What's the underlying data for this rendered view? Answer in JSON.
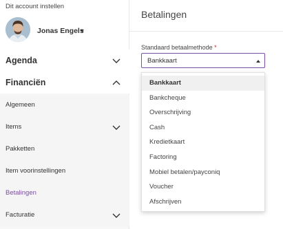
{
  "sidebar": {
    "account_label": "Dit account instellen",
    "user_name": "Jonas Engels",
    "sections": {
      "agenda": "Agenda",
      "financien": "Financiën"
    },
    "subitems": {
      "algemeen": "Algemeen",
      "items": "Items",
      "pakketten": "Pakketten",
      "item_voorinstellingen": "Item voorinstellingen",
      "betalingen": "Betalingen",
      "facturatie": "Facturatie"
    }
  },
  "main": {
    "title": "Betalingen",
    "field_label": "Standaard betaalmethode",
    "required_mark": "*",
    "selected_value": "Bankkaart"
  },
  "dropdown": {
    "options": [
      "Bankkaart",
      "Bankcheque",
      "Overschrijving",
      "Cash",
      "Kredietkaart",
      "Factoring",
      "Mobiel betalen/payconiq",
      "Voucher",
      "Afschrijven"
    ],
    "selected_index": 0
  },
  "colors": {
    "accent": "#7a4ea3",
    "required": "#c62828"
  }
}
